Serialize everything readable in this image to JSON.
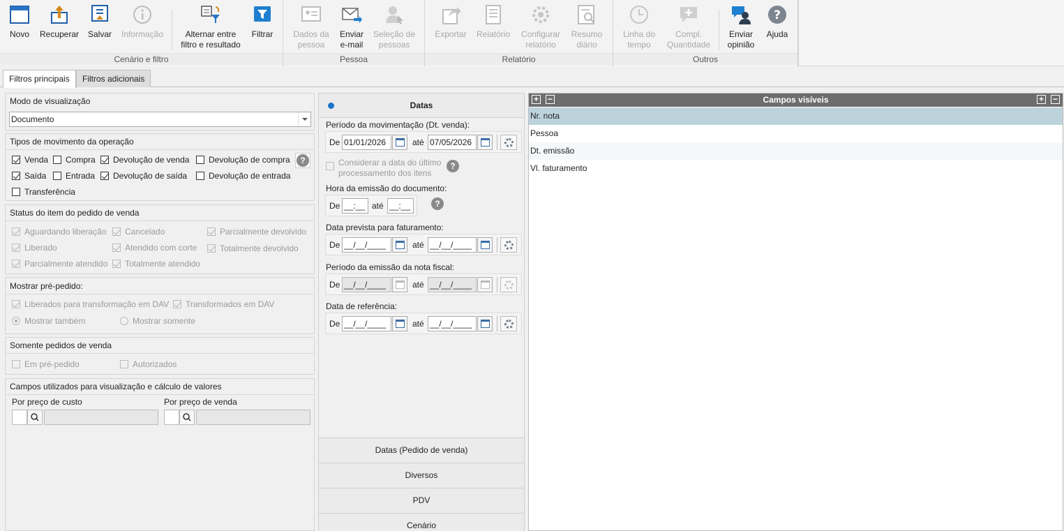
{
  "ribbon": {
    "groups": [
      {
        "label": "Cenário e filtro"
      },
      {
        "label": "Pessoa"
      },
      {
        "label": "Relatório"
      },
      {
        "label": "Outros"
      }
    ],
    "buttons": {
      "novo": "Novo",
      "recuperar": "Recuperar",
      "salvar": "Salvar",
      "informacao": "Informação",
      "alternar1": "Alternar entre",
      "alternar2": "filtro e resultado",
      "filtrar": "Filtrar",
      "dados1": "Dados da",
      "dados2": "pessoa",
      "enviar1": "Enviar",
      "enviar2": "e-mail",
      "selecao1": "Seleção de",
      "selecao2": "pessoas",
      "exportar": "Exportar",
      "relatorio": "Relatório",
      "config1": "Configurar",
      "config2": "relatório",
      "resumo1": "Resumo",
      "resumo2": "diário",
      "linha1": "Linha do",
      "linha2": "tempo",
      "compl1": "Compl.",
      "compl2": "Quantidade",
      "opiniao1": "Enviar",
      "opiniao2": "opinião",
      "ajuda": "Ajuda"
    }
  },
  "tabs": [
    "Filtros principais",
    "Filtros adicionais"
  ],
  "left": {
    "modo_title": "Modo de visualização",
    "modo_value": "Documento",
    "tipos_title": "Tipos de movimento da operação",
    "tipos": {
      "venda": "Venda",
      "compra": "Compra",
      "dev_venda": "Devolução de venda",
      "dev_compra": "Devolução de compra",
      "saida": "Saída",
      "entrada": "Entrada",
      "dev_saida": "Devolução de  saída",
      "dev_entrada": "Devolução de entrada",
      "transferencia": "Transferência"
    },
    "status_title": "Status do item do pedido de venda",
    "status": {
      "aguardando": "Aguardando liberação",
      "cancelado": "Cancelado",
      "parc_dev": "Parcialmente devolvido",
      "liberado": "Liberado",
      "atendido_corte": "Atendido com corte",
      "total_dev": "Totalmente devolvido",
      "parc_atendido": "Parcialmente atendido",
      "total_atendido": "Totalmente atendido"
    },
    "pre_title": "Mostrar pré-pedido:",
    "pre": {
      "liberados": "Liberados para transformação em DAV",
      "transformados": "Transformados em DAV",
      "tambem": "Mostrar também",
      "somente": "Mostrar somente"
    },
    "somente_title": "Somente pedidos de venda",
    "somente": {
      "em_pre": "Em pré-pedido",
      "autorizados": "Autorizados"
    },
    "campos_title": "Campos utilizados para visualização e cálculo de valores",
    "custo_label": "Por preço de custo",
    "venda_label": "Por preço de venda"
  },
  "middle": {
    "header": "Datas",
    "periodo_mov": "Período da movimentação (Dt. venda):",
    "de": "De",
    "ate": "até",
    "mov_de": "01/01/2026",
    "mov_ate": "07/05/2026",
    "considerar1": "Considerar a data do último",
    "considerar2": "processamento dos itens",
    "hora": "Hora da emissão do documento:",
    "hora_mask": "__:__",
    "prevista": "Data prevista para faturamento:",
    "date_mask": "__/__/____",
    "emissao_nf": "Período da emissão da nota fiscal:",
    "referencia": "Data de referência:",
    "accordion": [
      "Datas (Pedido de venda)",
      "Diversos",
      "PDV",
      "Cenário"
    ]
  },
  "right": {
    "header": "Campos visíveis",
    "rows": [
      "Nr. nota",
      "Pessoa",
      "Dt. emissão",
      "Vl. faturamento"
    ]
  }
}
